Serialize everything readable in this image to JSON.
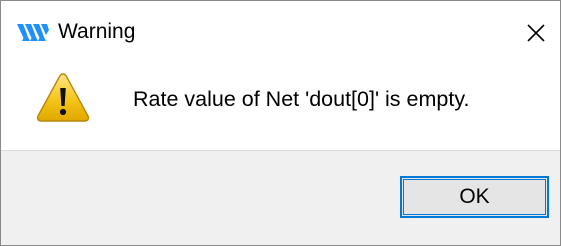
{
  "window": {
    "title": "Warning",
    "app_icon": "app-logo-icon",
    "close_icon": "close-icon"
  },
  "message": {
    "icon": "warning-triangle-icon",
    "text": "Rate value of Net 'dout[0]' is empty."
  },
  "buttons": {
    "ok_label": "OK"
  },
  "colors": {
    "accent": "#0078d7",
    "footer_bg": "#f0f0f0",
    "button_bg": "#e5e5e5",
    "app_icon": "#1e90ff",
    "warning_fill": "#f5c518"
  }
}
